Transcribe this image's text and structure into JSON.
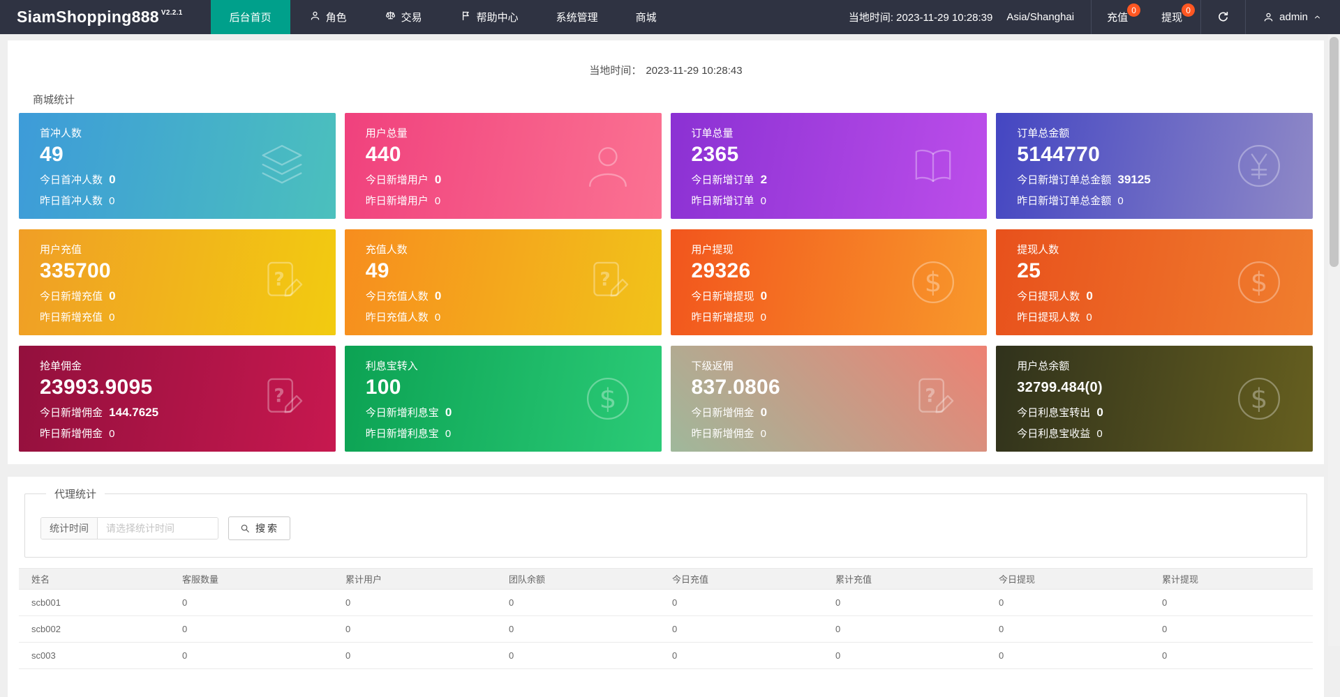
{
  "navbar": {
    "logo": "SiamShopping888",
    "version": "V2.2.1",
    "items": [
      {
        "id": "home",
        "label": "后台首页",
        "icon": null,
        "active": true
      },
      {
        "id": "roles",
        "label": "角色",
        "icon": "user-icon",
        "active": false
      },
      {
        "id": "trade",
        "label": "交易",
        "icon": "scales-icon",
        "active": false
      },
      {
        "id": "help",
        "label": "帮助中心",
        "icon": "flag-icon",
        "active": false
      },
      {
        "id": "system",
        "label": "系统管理",
        "icon": null,
        "active": false
      },
      {
        "id": "mall",
        "label": "商城",
        "icon": null,
        "active": false
      }
    ],
    "local_time": "当地时间: 2023-11-29 10:28:39",
    "timezone": "Asia/Shanghai",
    "recharge": {
      "label": "充值",
      "badge": "0"
    },
    "withdraw": {
      "label": "提现",
      "badge": "0"
    },
    "user": "admin"
  },
  "content": {
    "local_time_label": "当地时间：",
    "local_time_value": "2023-11-29 10:28:43",
    "stats_title": "商城统计",
    "cards": [
      {
        "id": "first-recharge-users",
        "title": "首冲人数",
        "value": "49",
        "small_value": false,
        "line1_label": "今日首冲人数",
        "line1_value": "0",
        "line2_label": "昨日首冲人数",
        "line2_value": "0",
        "icon": "layers-icon",
        "gradient": [
          "#3D9BD9",
          "#4BC0BD"
        ],
        "gradient_dir": "100deg"
      },
      {
        "id": "total-users",
        "title": "用户总量",
        "value": "440",
        "small_value": false,
        "line1_label": "今日新增用户",
        "line1_value": "0",
        "line2_label": "昨日新增用户",
        "line2_value": "0",
        "icon": "person-icon",
        "gradient": [
          "#F0417D",
          "#FB7292"
        ],
        "gradient_dir": "100deg"
      },
      {
        "id": "total-orders",
        "title": "订单总量",
        "value": "2365",
        "small_value": false,
        "line1_label": "今日新增订单",
        "line1_value": "2",
        "line2_label": "昨日新增订单",
        "line2_value": "0",
        "icon": "book-icon",
        "gradient": [
          "#8B31D3",
          "#BC4EEA"
        ],
        "gradient_dir": "100deg"
      },
      {
        "id": "order-total-amount",
        "title": "订单总金额",
        "value": "5144770",
        "small_value": false,
        "line1_label": "今日新增订单总金额",
        "line1_value": "39125",
        "line2_label": "昨日新增订单总金额",
        "line2_value": "0",
        "icon": "yuan-circle-icon",
        "gradient": [
          "#4446C2",
          "#8F89C7"
        ],
        "gradient_dir": "100deg"
      },
      {
        "id": "user-recharge",
        "title": "用户充值",
        "value": "335700",
        "small_value": false,
        "line1_label": "今日新增充值",
        "line1_value": "0",
        "line2_label": "昨日新增充值",
        "line2_value": "0",
        "icon": "doc-edit-icon",
        "gradient": [
          "#F09E26",
          "#F2CB10"
        ],
        "gradient_dir": "100deg"
      },
      {
        "id": "recharge-users",
        "title": "充值人数",
        "value": "49",
        "small_value": false,
        "line1_label": "今日充值人数",
        "line1_value": "0",
        "line2_label": "昨日充值人数",
        "line2_value": "0",
        "icon": "doc-edit-icon",
        "gradient": [
          "#F78D1E",
          "#F1C31A"
        ],
        "gradient_dir": "100deg"
      },
      {
        "id": "user-withdraw",
        "title": "用户提现",
        "value": "29326",
        "small_value": false,
        "line1_label": "今日新增提现",
        "line1_value": "0",
        "line2_label": "昨日新增提现",
        "line2_value": "0",
        "icon": "dollar-circle-icon",
        "gradient": [
          "#F2551D",
          "#F8992B"
        ],
        "gradient_dir": "100deg"
      },
      {
        "id": "withdraw-users",
        "title": "提现人数",
        "value": "25",
        "small_value": false,
        "line1_label": "今日提现人数",
        "line1_value": "0",
        "line2_label": "昨日提现人数",
        "line2_value": "0",
        "icon": "dollar-circle-icon",
        "gradient": [
          "#E8511C",
          "#F07E2E"
        ],
        "gradient_dir": "100deg"
      },
      {
        "id": "grab-commission",
        "title": "抢单佣金",
        "value": "23993.9095",
        "small_value": false,
        "line1_label": "今日新增佣金",
        "line1_value": "144.7625",
        "line2_label": "昨日新增佣金",
        "line2_value": "0",
        "icon": "doc-edit-icon",
        "gradient": [
          "#93103D",
          "#C7184F"
        ],
        "gradient_dir": "100deg"
      },
      {
        "id": "interest-transfer-in",
        "title": "利息宝转入",
        "value": "100",
        "small_value": false,
        "line1_label": "今日新增利息宝",
        "line1_value": "0",
        "line2_label": "昨日新增利息宝",
        "line2_value": "0",
        "icon": "dollar-circle-icon",
        "gradient": [
          "#0CA253",
          "#2BCB77"
        ],
        "gradient_dir": "100deg"
      },
      {
        "id": "sub-rebate",
        "title": "下级返佣",
        "value": "837.0806",
        "small_value": false,
        "line1_label": "今日新增佣金",
        "line1_value": "0",
        "line2_label": "昨日新增佣金",
        "line2_value": "0",
        "icon": "doc-edit-icon",
        "gradient": [
          "#9FB89B",
          "#ED8173"
        ],
        "gradient_dir": "45deg"
      },
      {
        "id": "user-total-balance",
        "title": "用户总余额",
        "value": "32799.484(0)",
        "small_value": true,
        "line1_label": "今日利息宝转出",
        "line1_value": "0",
        "line2_label": "今日利息宝收益",
        "line2_value": "0",
        "icon": "dollar-circle-icon",
        "gradient": [
          "#30321C",
          "#665F1F"
        ],
        "gradient_dir": "100deg"
      }
    ],
    "agent": {
      "legend": "代理统计",
      "time_label": "统计时间",
      "time_placeholder": "请选择统计时间",
      "search_label": "搜索",
      "table": {
        "headers": [
          "姓名",
          "客服数量",
          "累计用户",
          "团队余额",
          "今日充值",
          "累计充值",
          "今日提现",
          "累计提现"
        ],
        "rows": [
          [
            "scb001",
            "0",
            "0",
            "0",
            "0",
            "0",
            "0",
            "0"
          ],
          [
            "scb002",
            "0",
            "0",
            "0",
            "0",
            "0",
            "0",
            "0"
          ],
          [
            "sc003",
            "0",
            "0",
            "0",
            "0",
            "0",
            "0",
            "0"
          ]
        ]
      }
    }
  },
  "theme": {
    "navbar_bg": "#2F3342",
    "active_teal": "#00A08B",
    "badge_orange": "#FF5722"
  }
}
